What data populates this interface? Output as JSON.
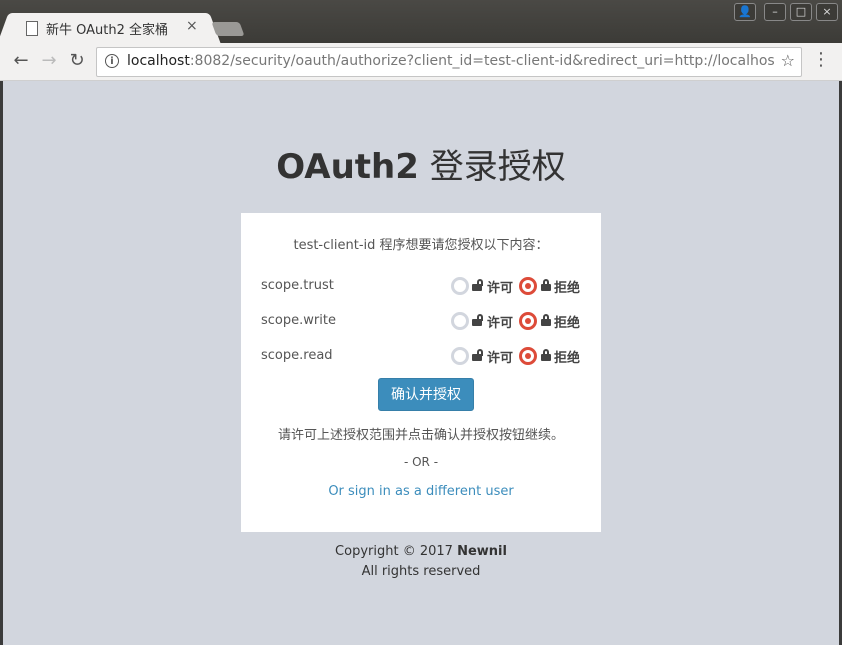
{
  "browser": {
    "tab_title": "新牛 OAuth2 全家桶",
    "tab_close": "×",
    "url_host": "localhost",
    "url_rest": ":8082/security/oauth/authorize?client_id=test-client-id&redirect_uri=http://localhost:8080/lo",
    "back_icon": "←",
    "forward_icon": "→",
    "reload_icon": "↻",
    "star_icon": "☆",
    "menu_icon": "⋮",
    "info_icon": "i",
    "window_buttons": {
      "user": "👤",
      "minimize": "–",
      "maximize": "□",
      "close": "×"
    }
  },
  "page": {
    "title_bold": "OAuth2",
    "title_rest": " 登录授权",
    "intro": "test-client-id 程序想要请您授权以下内容：",
    "allow_label": "许可",
    "deny_label": "拒绝",
    "scopes": [
      {
        "name": "scope.trust",
        "selected": "deny"
      },
      {
        "name": "scope.write",
        "selected": "deny"
      },
      {
        "name": "scope.read",
        "selected": "deny"
      }
    ],
    "submit_label": "确认并授权",
    "hint": "请许可上述授权范围并点击确认并授权按钮继续。",
    "or_text": "- OR -",
    "switch_user_link": "Or sign in as a different user",
    "footer_copyright": "Copyright © 2017 ",
    "footer_brand": "Newnil",
    "footer_rights": "All rights reserved"
  },
  "colors": {
    "accent": "#3c8dbc",
    "deny_selected": "#dd4b39",
    "background": "#d2d6de"
  }
}
